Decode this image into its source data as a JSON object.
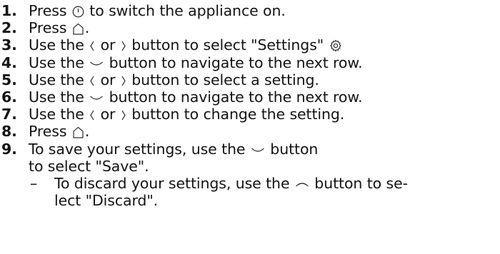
{
  "steps": [
    {
      "num": "1.",
      "pre": "Press ",
      "icon1": "power-icon",
      "post": " to switch the appliance on."
    },
    {
      "num": "2.",
      "pre": "Press ",
      "icon1": "home-icon",
      "post": "."
    },
    {
      "num": "3.",
      "pre": "Use the ",
      "icon1": "chevron-left-icon",
      "mid": " or ",
      "icon2": "chevron-right-icon",
      "post": " button to select \"Settings\" ",
      "icon3": "settings-gear-icon"
    },
    {
      "num": "4.",
      "pre": "Use the ",
      "icon1": "chevron-down-icon",
      "post": " button to navigate to the next row."
    },
    {
      "num": "5.",
      "pre": "Use the ",
      "icon1": "chevron-left-icon",
      "mid": " or ",
      "icon2": "chevron-right-icon",
      "post": " button to select a setting."
    },
    {
      "num": "6.",
      "pre": "Use the ",
      "icon1": "chevron-down-icon",
      "post": " button to navigate to the next row."
    },
    {
      "num": "7.",
      "pre": "Use the ",
      "icon1": "chevron-left-icon",
      "mid": " or ",
      "icon2": "chevron-right-icon",
      "post": " button to change the setting."
    },
    {
      "num": "8.",
      "pre": "Press ",
      "icon1": "home-icon",
      "post": "."
    },
    {
      "num": "9.",
      "pre": "To save your settings, use the ",
      "icon1": "chevron-down-icon",
      "post": " button to select \"Save\"."
    }
  ],
  "substep": {
    "dash": "–",
    "pre": "To discard your settings, use the ",
    "icon1": "chevron-up-icon",
    "post": " button to se­lect \"Discard\"."
  }
}
